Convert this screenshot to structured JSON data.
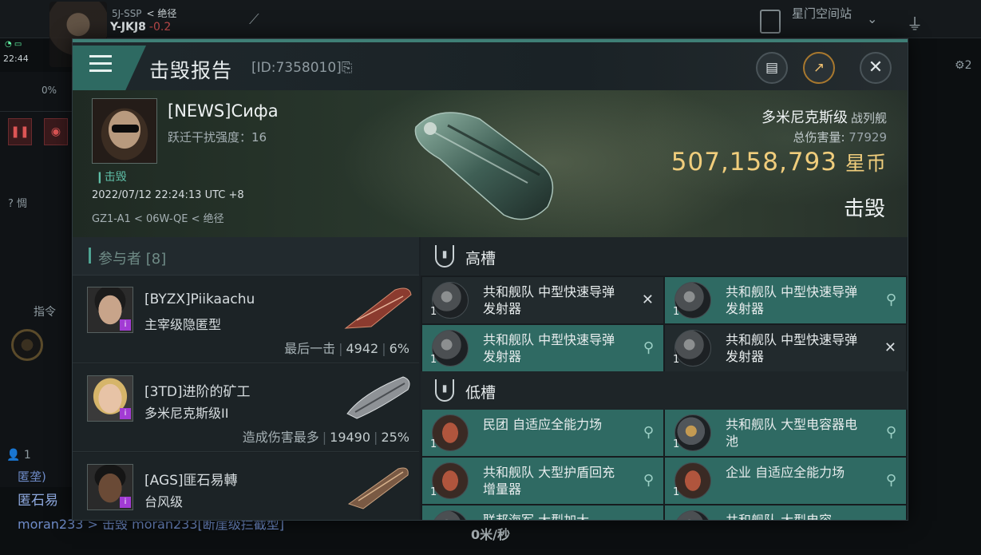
{
  "hud": {
    "system_top": "5J-SSP",
    "system_top_note": "< 绝径",
    "system_main": "Y-JKJ8",
    "system_sec": "-0.2",
    "clock": "22:44",
    "pct": "0%",
    "char_label": "?",
    "char_label2": "惆",
    "command_label": "指令",
    "fleet_count": "1",
    "dock_label": "星门空间站",
    "chat_line1": "匿垄)",
    "chat_line2": "匿石易",
    "chat_line3": "moran233 > 击毁 moran233[断崖级拦截型]",
    "speed": "0米/秒",
    "right_count": "2"
  },
  "report": {
    "title": "击毁报告",
    "id_text": "[ID:7358010]",
    "victim": {
      "name": "[NEWS]Сифа",
      "warp_label": "跃迁干扰强度：16",
      "tag": "击毁",
      "time": "2022/07/12 22:24:13 UTC +8",
      "location": "GZ1-A1 < 06W-QE < 绝径",
      "ship_class": "多米尼克斯级",
      "ship_type": "战列舰",
      "total_damage_label": "总伤害量:",
      "total_damage_value": "77929",
      "isk_value": "507,158,793",
      "isk_unit": "星币",
      "status": "击毁"
    },
    "participants": {
      "header": "参与者 [8]",
      "rows": [
        {
          "name": "[BYZX]Piikaachu",
          "ship": "主宰级隐匿型",
          "role": "最后一击",
          "damage": "4942",
          "pct": "6%"
        },
        {
          "name": "[3TD]进阶的矿工",
          "ship": "多米尼克斯级II",
          "role": "造成伤害最多",
          "damage": "19490",
          "pct": "25%"
        },
        {
          "name": "[AGS]匪石易轉",
          "ship": "台风级",
          "role": "",
          "damage": "",
          "pct": ""
        }
      ]
    },
    "slots": {
      "high_label": "高槽",
      "low_label": "低槽",
      "high": [
        {
          "name": "共和舰队 中型快速导弹发射器",
          "qty": "1",
          "status": "destroyed"
        },
        {
          "name": "共和舰队 中型快速导弹发射器",
          "qty": "1",
          "status": "dropped"
        },
        {
          "name": "共和舰队 中型快速导弹发射器",
          "qty": "1",
          "status": "dropped"
        },
        {
          "name": "共和舰队 中型快速导弹发射器",
          "qty": "1",
          "status": "destroyed"
        }
      ],
      "low": [
        {
          "name": "民团 自适应全能力场",
          "qty": "1",
          "status": "dropped"
        },
        {
          "name": "共和舰队 大型电容器电池",
          "qty": "1",
          "status": "dropped"
        },
        {
          "name": "共和舰队 大型护盾回充增量器",
          "qty": "1",
          "status": "dropped"
        },
        {
          "name": "企业 自适应全能力场",
          "qty": "1",
          "status": "dropped"
        },
        {
          "name": "联邦海军 大型加大",
          "qty": "",
          "status": ""
        },
        {
          "name": "共和舰队 大型电容",
          "qty": "",
          "status": ""
        }
      ]
    }
  }
}
